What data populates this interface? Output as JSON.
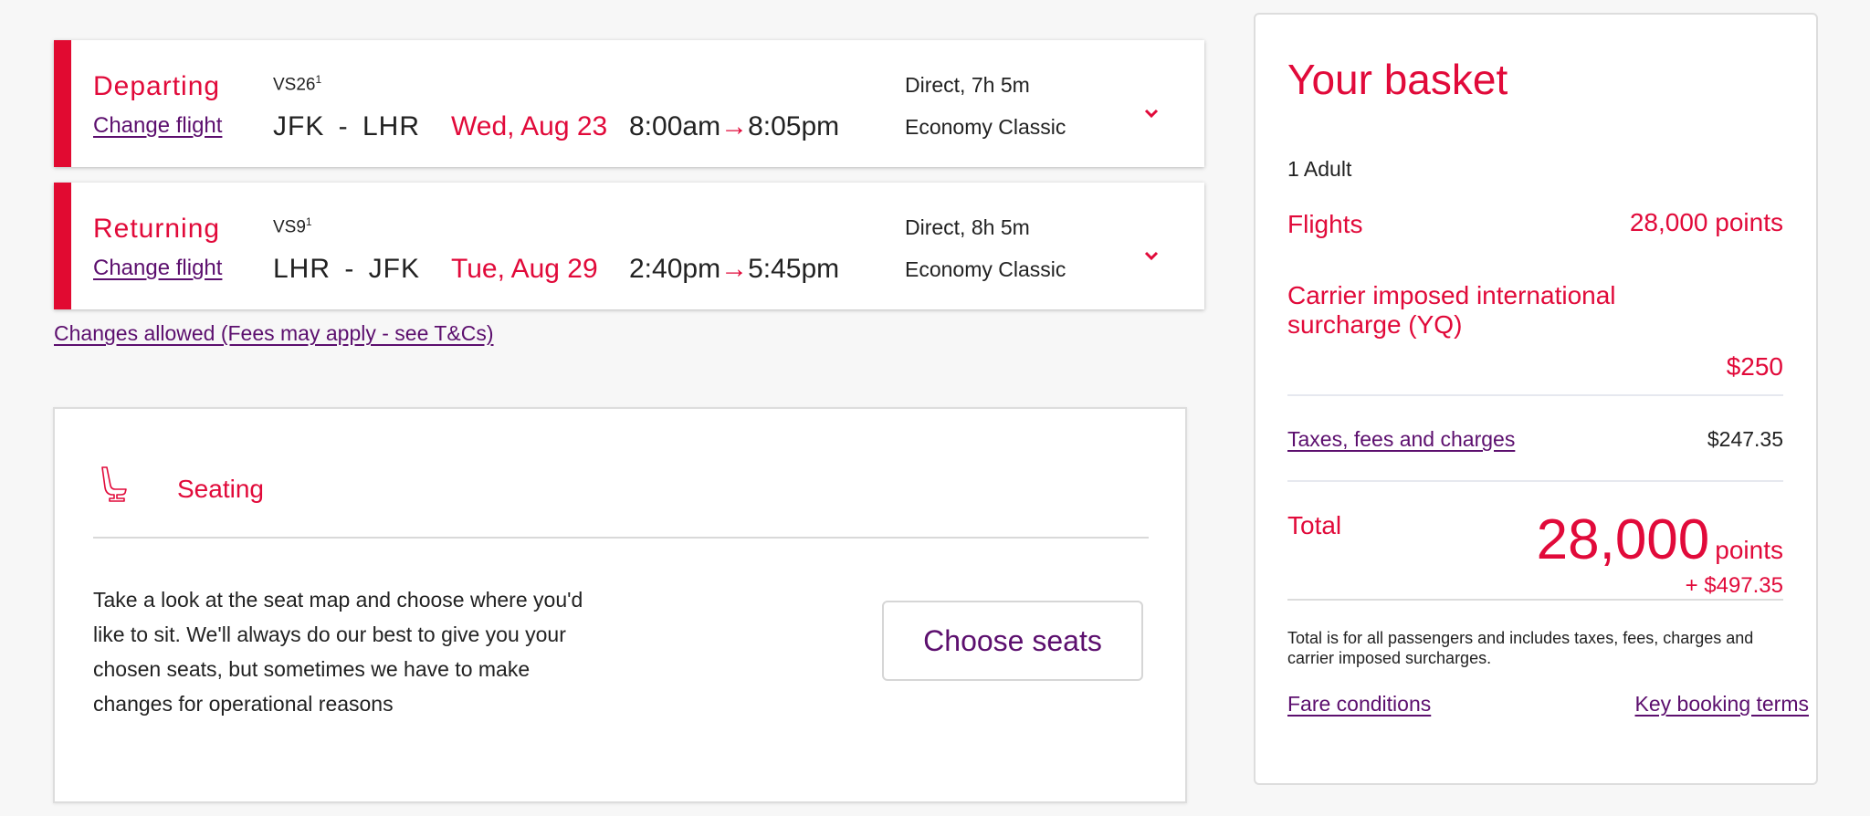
{
  "colors": {
    "brand_red": "#e10a3a",
    "link_purple": "#5c0f6e"
  },
  "flights": [
    {
      "direction": "Departing",
      "change_label": "Change flight",
      "flight_number": "VS26",
      "flight_sup": "1",
      "route": "JFK - LHR",
      "date": "Wed, Aug 23",
      "depart_time": "8:00am",
      "arrow": "→",
      "arrive_time": "8:05pm",
      "duration": "Direct, 7h 5m",
      "cabin": "Economy Classic",
      "expand_icon": "chevron-down-icon"
    },
    {
      "direction": "Returning",
      "change_label": "Change flight",
      "flight_number": "VS9",
      "flight_sup": "1",
      "route": "LHR - JFK",
      "date": "Tue, Aug 29",
      "depart_time": "2:40pm",
      "arrow": "→",
      "arrive_time": "5:45pm",
      "duration": "Direct, 8h 5m",
      "cabin": "Economy Classic",
      "expand_icon": "chevron-down-icon"
    }
  ],
  "changes_link": "Changes allowed (Fees may apply - see T&Cs)",
  "seating": {
    "icon": "seat-icon",
    "title": "Seating",
    "description": "Take a look at the seat map and choose where you'd like to sit. We'll always do our best to give you your chosen seats, but sometimes we have to make changes for operational reasons",
    "button_label": "Choose seats"
  },
  "basket": {
    "title": "Your basket",
    "passengers": "1 Adult",
    "flights_label": "Flights",
    "flights_value": "28,000 points",
    "surcharge_label": "Carrier imposed international surcharge (YQ)",
    "surcharge_value": "$250",
    "taxes_label": "Taxes, fees and charges",
    "taxes_value": "$247.35",
    "total_label": "Total",
    "total_points": "28,000",
    "total_points_unit": "points",
    "total_cash": "+ $497.35",
    "note": "Total is for all passengers and includes taxes, fees, charges and carrier imposed surcharges.",
    "fare_conditions_link": "Fare conditions",
    "key_terms_link": "Key booking terms"
  }
}
